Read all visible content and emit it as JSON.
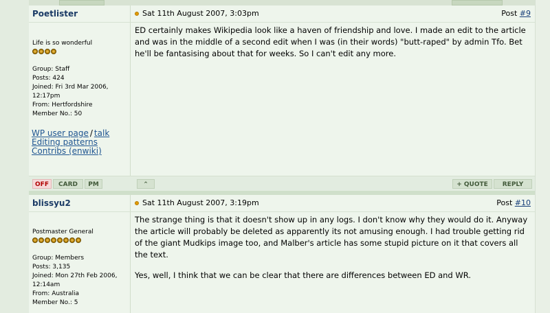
{
  "posts": [
    {
      "author": "Poetlister",
      "date": "Sat 11th August 2007, 3:03pm",
      "post_label": "Post",
      "post_number": "#9",
      "title": "Life is so wonderful",
      "pips": 4,
      "group": "Group: Staff",
      "posts": "Posts: 424",
      "joined": "Joined: Fri 3rd Mar 2006, 12:17pm",
      "from": "From: Hertfordshire",
      "member_no": "Member No.: 50",
      "links": {
        "wp_user_page": "WP user page",
        "talk": "talk",
        "editing_patterns": "Editing patterns",
        "contribs": "Contribs (enwiki)"
      },
      "paragraphs": [
        "ED certainly makes Wikipedia look like a haven of friendship and love. I made an edit to the article and was in the middle of a second edit when I was (in their words) \"butt-raped\" by admin Tfo. Bet he'll be fantasising about that for weeks. So I can't edit any more."
      ],
      "footer": {
        "off": "OFF",
        "card": "CARD",
        "pm": "PM",
        "top": "⌃",
        "quote": "+ QUOTE",
        "reply": "REPLY"
      }
    },
    {
      "author": "blissyu2",
      "date": "Sat 11th August 2007, 3:19pm",
      "post_label": "Post",
      "post_number": "#10",
      "title": "Postmaster General",
      "pips": 8,
      "group": "Group: Members",
      "posts": "Posts: 3,135",
      "joined": "Joined: Mon 27th Feb 2006, 12:14am",
      "from": "From: Australia",
      "member_no": "Member No.: 5",
      "paragraphs": [
        "The strange thing is that it doesn't show up in any logs. I don't know why they would do it. Anyway the article will probably be deleted as apparently its not amusing enough. I had trouble getting rid of the giant Mudkips image too, and Malber's article has some stupid picture on it that covers all the text.",
        "Yes, well, I think that we can be clear that there are differences between ED and WR."
      ]
    }
  ]
}
